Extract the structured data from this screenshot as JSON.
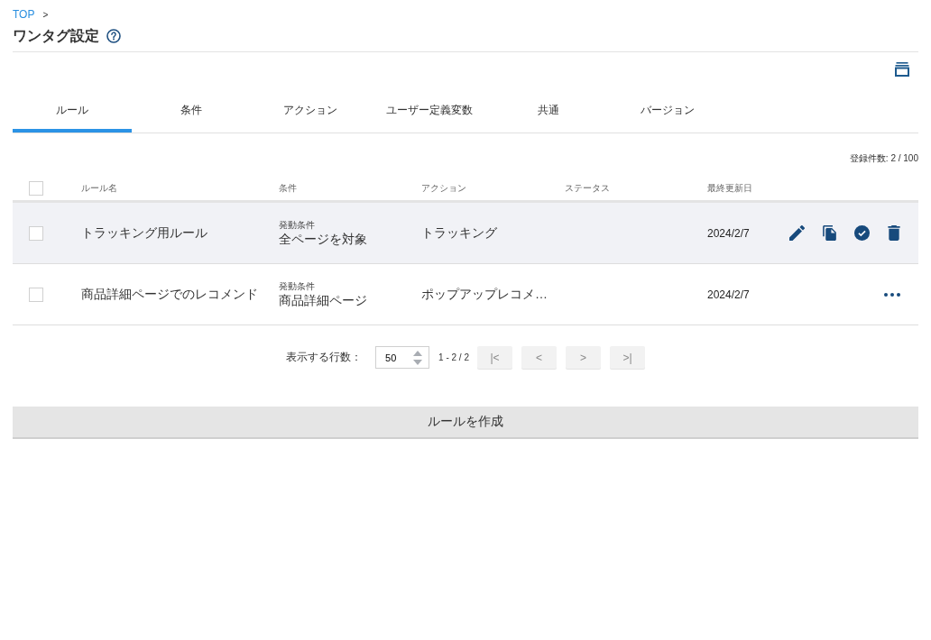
{
  "breadcrumb": {
    "items": [
      "TOP"
    ],
    "separator": ">"
  },
  "page": {
    "title": "ワンタグ設定"
  },
  "tabs": [
    {
      "label": "ルール",
      "selected": true
    },
    {
      "label": "条件",
      "selected": false
    },
    {
      "label": "アクション",
      "selected": false
    },
    {
      "label": "ユーザー定義変数",
      "selected": false
    },
    {
      "label": "共通",
      "selected": false
    },
    {
      "label": "バージョン",
      "selected": false
    }
  ],
  "record_count": "登録件数: 2 / 100",
  "table": {
    "header_checkbox": {
      "checked": false
    },
    "columns": [
      "ルール名",
      "条件",
      "アクション",
      "ステータス",
      "最終更新日"
    ],
    "rows": [
      {
        "checked": false,
        "hovered": true,
        "name": "トラッキング用ルール",
        "condition_label": "発動条件",
        "condition": "全ページを対象",
        "action": "トラッキング",
        "updated": "2024/2/7"
      },
      {
        "checked": false,
        "hovered": false,
        "name": "商品詳細ページでのレコメンド",
        "condition_label": "発動条件",
        "condition": "商品詳細ページ",
        "action": "ポップアップレコメ…",
        "updated": "2024/2/7"
      }
    ]
  },
  "pagination": {
    "rows_label": "表示する行数：",
    "rows_per_page": "50",
    "range": "1 - 2 / 2",
    "buttons": [
      {
        "label": "|<",
        "disabled": true
      },
      {
        "label": "<",
        "disabled": true
      },
      {
        "label": ">",
        "disabled": true
      },
      {
        "label": ">|",
        "disabled": true
      }
    ]
  },
  "create_button": "ルールを作成"
}
